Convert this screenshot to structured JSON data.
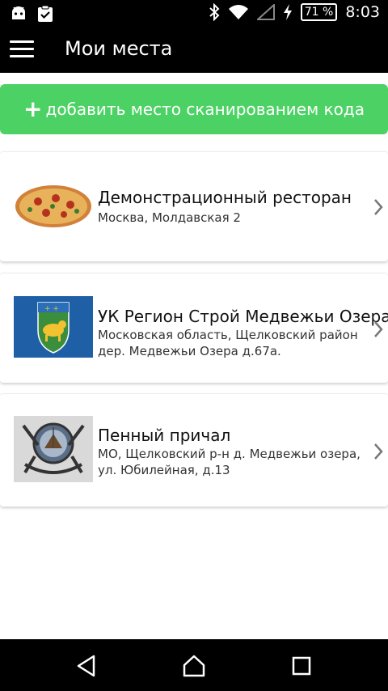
{
  "status_bar": {
    "time": "8:03",
    "battery": "71 %",
    "icons": [
      "android-icon",
      "clipboard-check-icon",
      "bluetooth-icon",
      "wifi-icon",
      "signal-icon",
      "charging-icon",
      "battery-icon"
    ]
  },
  "app_bar": {
    "title": "Мои места",
    "menu_icon": "hamburger-menu-icon"
  },
  "add_button": {
    "label": "добавить место сканированием кода",
    "icon": "plus-icon",
    "color": "#4cd264"
  },
  "places": [
    {
      "name": "Демонстрационный ресторан",
      "address": "Москва, Молдавская 2",
      "thumb": "pizza-image"
    },
    {
      "name": "УК Регион Строй Медвежьи Озера",
      "address": "Московская область, Щелковский район дер. Медвежьи Озера д.67а.",
      "thumb": "coat-of-arms-bear-image"
    },
    {
      "name": "Пенный причал",
      "address": "МО, Щелковский р-н д. Медвежьи озера, ул. Юбилейная, д.13",
      "thumb": "anchor-ship-logo-image"
    }
  ],
  "nav_bar": {
    "icons": [
      "back-icon",
      "home-icon",
      "recents-icon"
    ]
  }
}
